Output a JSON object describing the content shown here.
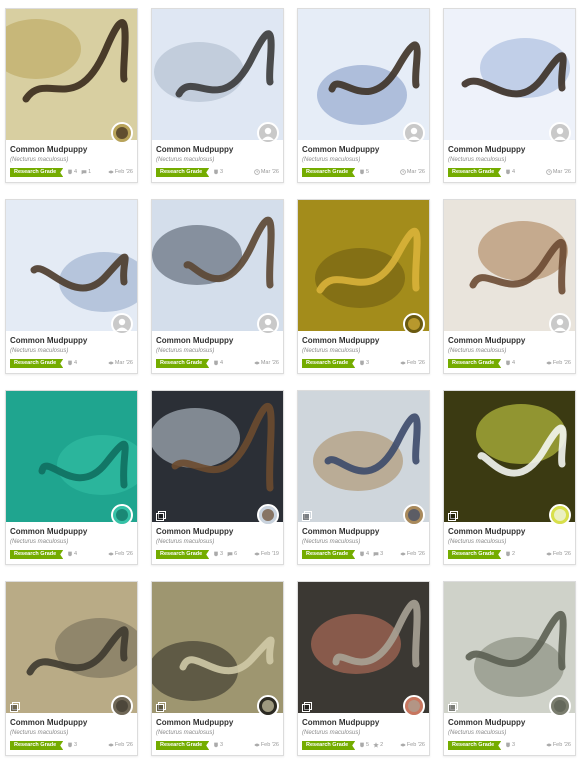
{
  "cards": [
    {
      "name": "Common Mudpuppy",
      "sci": "(Necturus maculosus)",
      "grade": "Research Grade",
      "ids": "4",
      "comments": "1",
      "date": "Feb '26",
      "date_icon": "eye-icon",
      "avatar": "photo-avatar",
      "photo_colors": [
        "#d8cfa1",
        "#b9a45a",
        "#3a2a1c"
      ]
    },
    {
      "name": "Common Mudpuppy",
      "sci": "(Necturus maculosus)",
      "grade": "Research Grade",
      "ids": "3",
      "comments": "",
      "date": "Mar '26",
      "date_icon": "clock-icon",
      "avatar": "default-user-icon",
      "photo_colors": [
        "#dfe7f3",
        "#a9b8c9",
        "#3a3a3a"
      ]
    },
    {
      "name": "Common Mudpuppy",
      "sci": "(Necturus maculosus)",
      "grade": "Research Grade",
      "ids": "5",
      "comments": "",
      "date": "Mar '26",
      "date_icon": "clock-icon",
      "avatar": "default-user-icon",
      "photo_colors": [
        "#e6edf7",
        "#7f97c4",
        "#3d3125"
      ]
    },
    {
      "name": "Common Mudpuppy",
      "sci": "(Necturus maculosus)",
      "grade": "Research Grade",
      "ids": "4",
      "comments": "",
      "date": "Mar '26",
      "date_icon": "clock-icon",
      "avatar": "default-user-icon",
      "photo_colors": [
        "#eef2fa",
        "#9db2d9",
        "#3b2f25"
      ]
    },
    {
      "name": "Common Mudpuppy",
      "sci": "(Necturus maculosus)",
      "grade": "Research Grade",
      "ids": "4",
      "comments": "",
      "date": "Mar '26",
      "date_icon": "eye-icon",
      "avatar": "default-user-icon",
      "photo_colors": [
        "#e4ebf5",
        "#8fa5c7",
        "#4a3a2a"
      ]
    },
    {
      "name": "Common Mudpuppy",
      "sci": "(Necturus maculosus)",
      "grade": "Research Grade",
      "ids": "4",
      "comments": "",
      "date": "Mar '26",
      "date_icon": "eye-icon",
      "avatar": "default-user-icon",
      "photo_colors": [
        "#d4deeb",
        "#45505e",
        "#5b4632"
      ]
    },
    {
      "name": "Common Mudpuppy",
      "sci": "(Necturus maculosus)",
      "grade": "Research Grade",
      "ids": "3",
      "comments": "",
      "date": "Feb '26",
      "date_icon": "eye-icon",
      "avatar": "photo-avatar",
      "photo_colors": [
        "#a38c1b",
        "#6b5a10",
        "#d9b23a"
      ]
    },
    {
      "name": "Common Mudpuppy",
      "sci": "(Necturus maculosus)",
      "grade": "Research Grade",
      "ids": "4",
      "comments": "",
      "date": "Feb '26",
      "date_icon": "eye-icon",
      "avatar": "default-user-icon",
      "photo_colors": [
        "#e9e4dc",
        "#a87a4e",
        "#6b4a33"
      ]
    },
    {
      "name": "Common Mudpuppy",
      "sci": "(Necturus maculosus)",
      "grade": "Research Grade",
      "ids": "4",
      "comments": "",
      "date": "Feb '26",
      "date_icon": "eye-icon",
      "avatar": "photo-avatar",
      "photo_colors": [
        "#1fa58f",
        "#35c2a7",
        "#0f6f60"
      ]
    },
    {
      "name": "Common Mudpuppy",
      "sci": "(Necturus maculosus)",
      "grade": "Research Grade",
      "ids": "3",
      "comments": "6",
      "date": "Feb '19",
      "date_icon": "eye-icon",
      "avatar": "photo-avatar",
      "photo_colors": [
        "#2b2f36",
        "#c9d3de",
        "#6b4b2f"
      ]
    },
    {
      "name": "Common Mudpuppy",
      "sci": "(Necturus maculosus)",
      "grade": "Research Grade",
      "ids": "4",
      "comments": "3",
      "date": "Feb '26",
      "date_icon": "eye-icon",
      "avatar": "photo-avatar",
      "photo_colors": [
        "#cfd6dc",
        "#a98a5c",
        "#3c4a6a"
      ]
    },
    {
      "name": "Common Mudpuppy",
      "sci": "(Necturus maculosus)",
      "grade": "Research Grade",
      "ids": "2",
      "comments": "",
      "date": "Feb '26",
      "date_icon": "eye-icon",
      "avatar": "photo-avatar",
      "photo_colors": [
        "#3b3a12",
        "#d8e04a",
        "#f4f6f2"
      ]
    },
    {
      "name": "Common Mudpuppy",
      "sci": "(Necturus maculosus)",
      "grade": "Research Grade",
      "ids": "3",
      "comments": "",
      "date": "Feb '26",
      "date_icon": "eye-icon",
      "avatar": "photo-avatar",
      "photo_colors": [
        "#b9ab86",
        "#6f6756",
        "#3e3a30"
      ]
    },
    {
      "name": "Common Mudpuppy",
      "sci": "(Necturus maculosus)",
      "grade": "Research Grade",
      "ids": "3",
      "comments": "",
      "date": "Feb '26",
      "date_icon": "eye-icon",
      "avatar": "photo-avatar",
      "photo_colors": [
        "#9e9670",
        "#2c2a22",
        "#cfc9a6"
      ]
    },
    {
      "name": "Common Mudpuppy",
      "sci": "(Necturus maculosus)",
      "grade": "Research Grade",
      "ids": "5",
      "comments": "2",
      "date": "Feb '26",
      "date_icon": "eye-icon",
      "avatar": "photo-avatar",
      "photo_colors": [
        "#3b3833",
        "#c8765f",
        "#a9a295"
      ]
    },
    {
      "name": "Common Mudpuppy",
      "sci": "(Necturus maculosus)",
      "grade": "Research Grade",
      "ids": "3",
      "comments": "",
      "date": "Feb '26",
      "date_icon": "eye-icon",
      "avatar": "photo-avatar",
      "photo_colors": [
        "#cfd2c9",
        "#7a7d6e",
        "#5b5f52"
      ]
    }
  ],
  "multi_photo_cards": [
    9,
    10,
    11,
    12,
    13,
    14,
    15
  ],
  "comment_icon_cards": [
    0,
    9,
    10
  ],
  "star_icon_cards": [
    14
  ]
}
